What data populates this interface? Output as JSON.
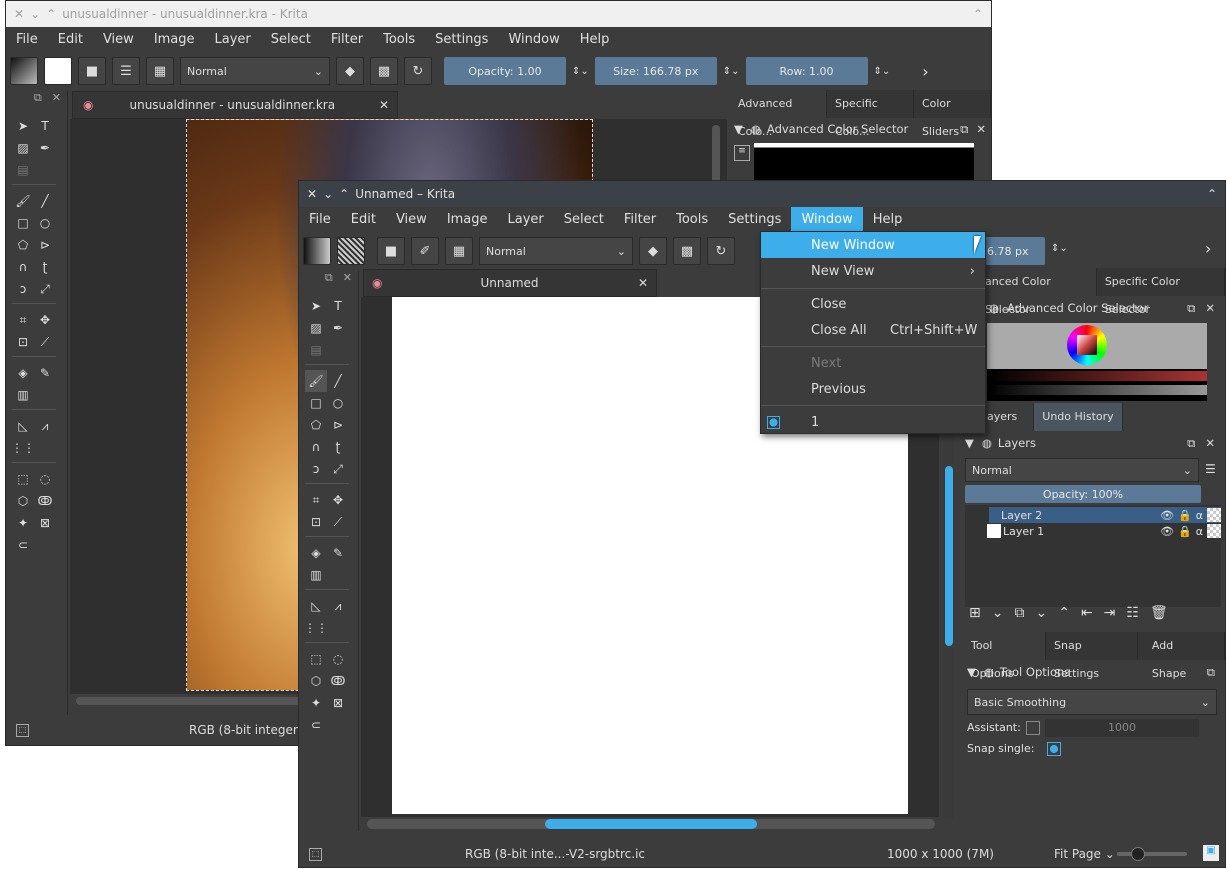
{
  "back_window": {
    "title": "unusualdinner - unusualdinner.kra - Krita",
    "menu": [
      "File",
      "Edit",
      "View",
      "Image",
      "Layer",
      "Select",
      "Filter",
      "Tools",
      "Settings",
      "Window",
      "Help"
    ],
    "blend_mode": "Normal",
    "opacity": "Opacity:  1.00",
    "size": "Size:  166.78 px",
    "row": "Row:  1.00",
    "doc_tab": "unusualdinner - unusualdinner.kra",
    "docker_tabs": [
      "Advanced Colo...",
      "Specific Colo...",
      "Color Sliders"
    ],
    "docker_title": "Advanced Color Selector",
    "status": "RGB (8-bit integer"
  },
  "front_window": {
    "title": "Unnamed – Krita",
    "menu": [
      "File",
      "Edit",
      "View",
      "Image",
      "Layer",
      "Select",
      "Filter",
      "Tools",
      "Settings",
      "Window",
      "Help"
    ],
    "active_menu": "Window",
    "blend_mode": "Normal",
    "size_partial": "6.78 px",
    "doc_tab": "Unnamed",
    "color_tabs": [
      "anced Color Selector",
      "Specific Color Selector"
    ],
    "color_docker_title": "Advanced Color Selector",
    "layer_tabs": [
      "ayers",
      "Undo History"
    ],
    "layers_title": "Layers",
    "layers_blend": "Normal",
    "layers_opacity": "Opacity:  100%",
    "layers": [
      "Layer 2",
      "Layer 1"
    ],
    "tool_tabs": [
      "Tool Options",
      "Snap Settings",
      "Add Shape"
    ],
    "tool_options_title": "Tool Options",
    "smoothing": "Basic Smoothing",
    "assistant_label": "Assistant:",
    "assistant_value": "1000",
    "snap_label": "Snap single:",
    "status_color": "RGB (8-bit inte...-V2-srgbtrc.ic",
    "status_size": "1000 x 1000 (7M)",
    "fit": "Fit Page"
  },
  "window_menu": {
    "items": [
      {
        "label": "New Window",
        "shortcut": ""
      },
      {
        "label": "New View",
        "shortcut": ""
      },
      {
        "label": "Close",
        "shortcut": ""
      },
      {
        "label": "Close All",
        "shortcut": "Ctrl+Shift+W"
      },
      {
        "label": "Next",
        "shortcut": ""
      },
      {
        "label": "Previous",
        "shortcut": ""
      },
      {
        "label": "1",
        "shortcut": ""
      }
    ]
  },
  "colors": {
    "accent": "#3daee9",
    "slider": "#5a7a98",
    "bg": "#3c3c3c"
  }
}
